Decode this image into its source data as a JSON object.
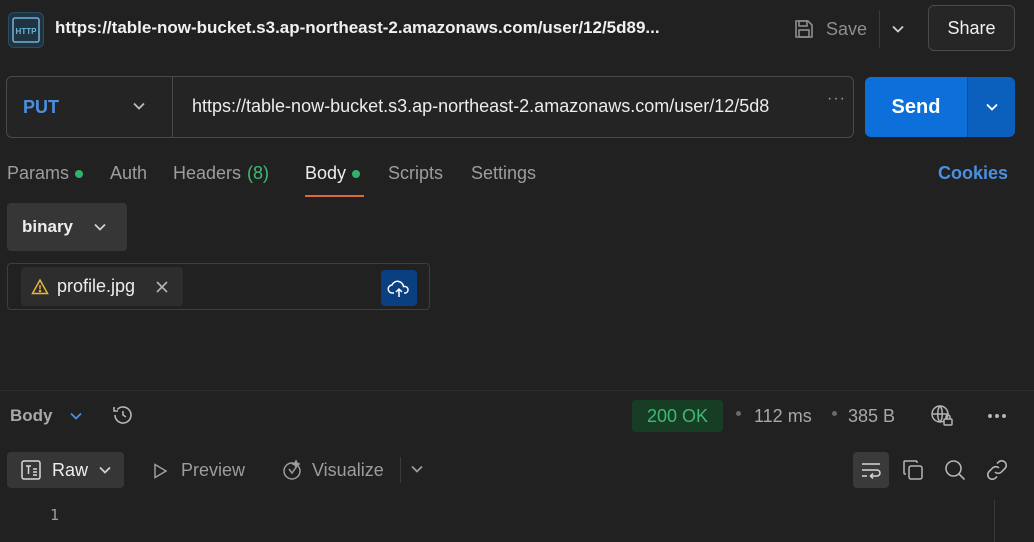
{
  "tab": {
    "icon_label": "HTTP",
    "title": "https://table-now-bucket.s3.ap-northeast-2.amazonaws.com/user/12/5d89..."
  },
  "header": {
    "save_label": "Save",
    "share_label": "Share"
  },
  "request": {
    "method": "PUT",
    "url": "https://table-now-bucket.s3.ap-northeast-2.amazonaws.com/user/12/5d8",
    "url_overflow": "···",
    "send_label": "Send"
  },
  "request_tabs": [
    {
      "label": "Params",
      "dot": true
    },
    {
      "label": "Auth"
    },
    {
      "label": "Headers",
      "count": "(8)"
    },
    {
      "label": "Body",
      "dot": true,
      "active": true
    },
    {
      "label": "Scripts"
    },
    {
      "label": "Settings"
    }
  ],
  "cookies_label": "Cookies",
  "body": {
    "mode": "binary",
    "file_name": "profile.jpg"
  },
  "response": {
    "section_label": "Body",
    "status": "200 OK",
    "time": "112 ms",
    "size": "385 B",
    "format": "Raw",
    "preview_label": "Preview",
    "visualize_label": "Visualize",
    "line_numbers": [
      "1"
    ]
  },
  "colors": {
    "accent_blue": "#0d6fd9",
    "link_blue": "#4a90e2",
    "success_green": "#3dbb75",
    "tab_underline": "#e0673a",
    "warning_yellow": "#e8b73a"
  },
  "icons": [
    "http-file-icon",
    "save-icon",
    "chevron-down-icon",
    "warning-icon",
    "close-icon",
    "cloud-upload-icon",
    "history-icon",
    "globe-lock-icon",
    "more-horizontal-icon",
    "raw-text-icon",
    "play-icon",
    "visualize-icon",
    "word-wrap-icon",
    "copy-icon",
    "search-icon",
    "link-icon"
  ]
}
